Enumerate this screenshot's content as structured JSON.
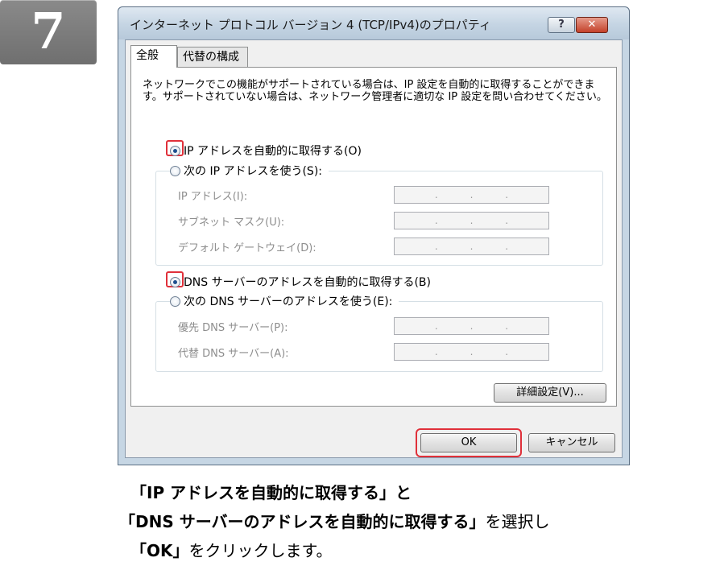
{
  "step": {
    "number": "7"
  },
  "window": {
    "title": "インターネット プロトコル バージョン 4 (TCP/IPv4)のプロパティ",
    "help_label": "?",
    "close_label": "✕"
  },
  "tabs": [
    {
      "label": "全般"
    },
    {
      "label": "代替の構成"
    }
  ],
  "intro_text": "ネットワークでこの機能がサポートされている場合は、IP 設定を自動的に取得することができます。サポートされていない場合は、ネットワーク管理者に適切な IP 設定を問い合わせてください。",
  "ip_section": {
    "auto_label": "IP アドレスを自動的に取得する(O)",
    "manual_label": "次の IP アドレスを使う(S):",
    "fields": [
      {
        "label": "IP アドレス(I):"
      },
      {
        "label": "サブネット マスク(U):"
      },
      {
        "label": "デフォルト ゲートウェイ(D):"
      }
    ]
  },
  "dns_section": {
    "auto_label": "DNS サーバーのアドレスを自動的に取得する(B)",
    "manual_label": "次の DNS サーバーのアドレスを使う(E):",
    "fields": [
      {
        "label": "優先 DNS サーバー(P):"
      },
      {
        "label": "代替 DNS サーバー(A):"
      }
    ]
  },
  "ip_dot": ".",
  "buttons": {
    "advanced": "詳細設定(V)...",
    "ok": "OK",
    "cancel": "キャンセル"
  },
  "caption": {
    "line1": "「IP アドレスを自動的に取得する」と",
    "line2_bold": "「DNS サーバーのアドレスを自動的に取得する」",
    "line2_normal": "を選択し",
    "line3_bold": "「OK」",
    "line3_normal": "をクリックします。"
  },
  "colors": {
    "highlight": "#e0303a",
    "badge": "#7a7a7a"
  }
}
